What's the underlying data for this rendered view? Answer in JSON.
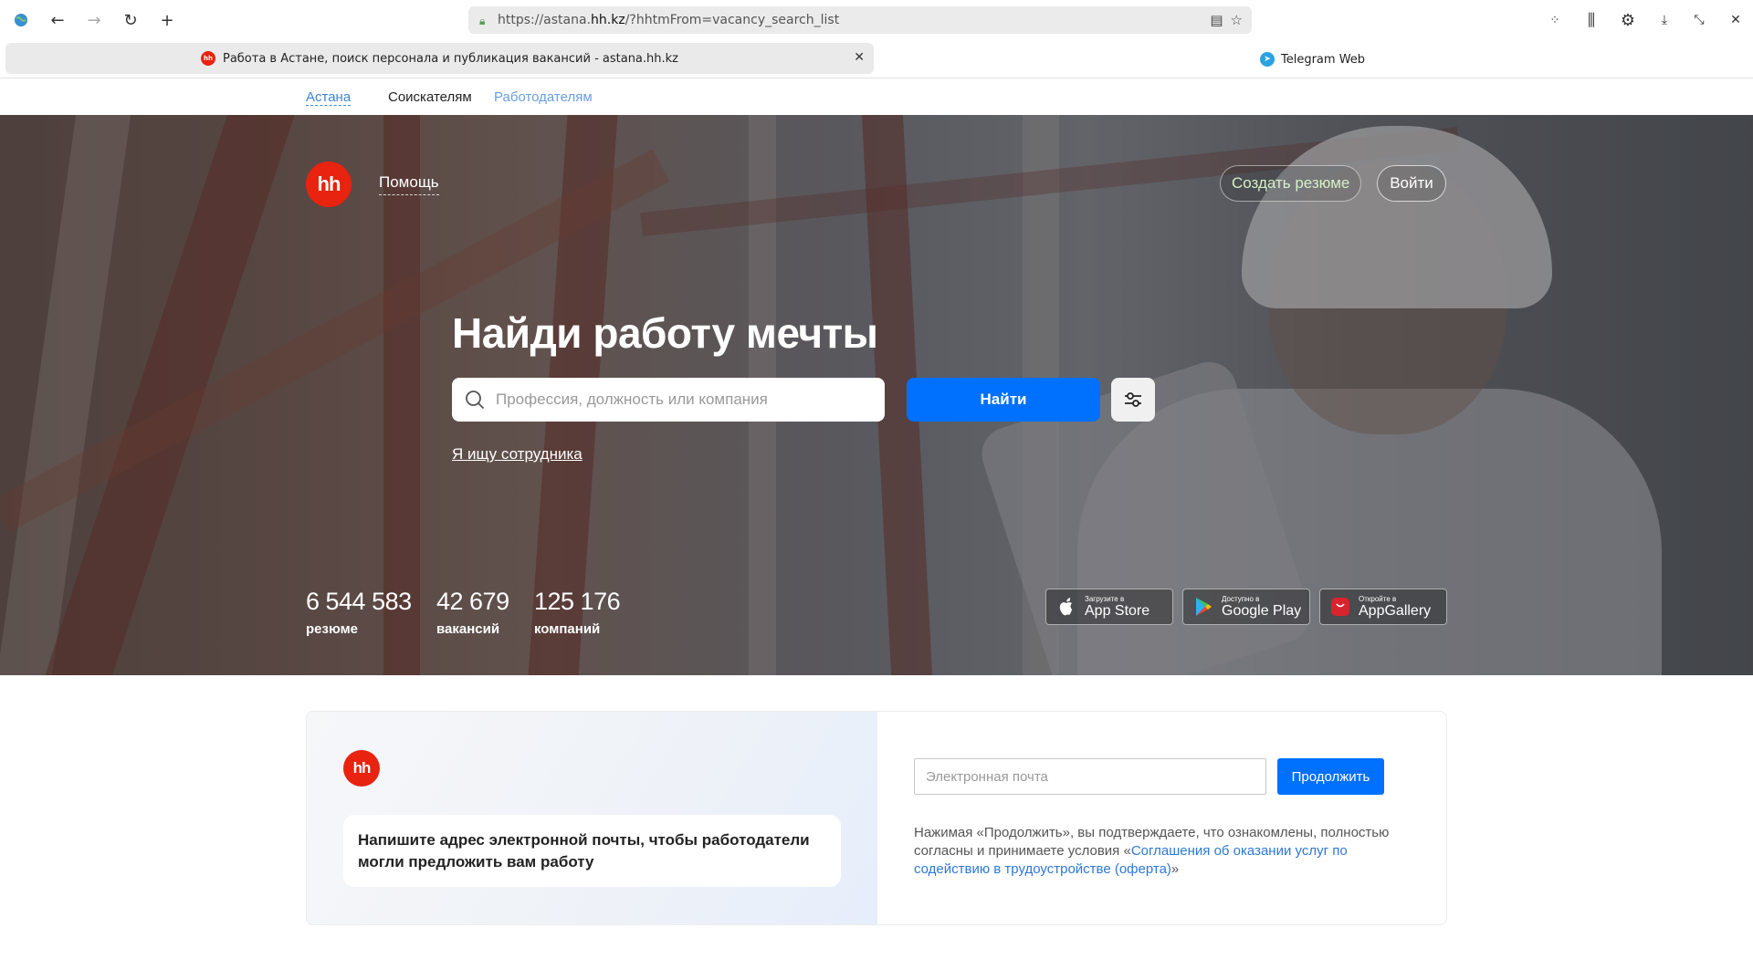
{
  "browser": {
    "url_prefix": "https://astana.",
    "url_host": "hh.kz",
    "url_rest": "/?hhtmFrom=vacancy_search_list",
    "active_tab_title": "Работа в Астане, поиск персонала и публикация вакансий - astana.hh.kz",
    "active_tab_favicon": "hh",
    "other_tab_title": "Telegram Web"
  },
  "topnav": {
    "city": "Астана",
    "seekers": "Соискателям",
    "employers": "Работодателям"
  },
  "header": {
    "logo": "hh",
    "help": "Помощь",
    "create_resume": "Создать резюме",
    "login": "Войти"
  },
  "hero": {
    "title": "Найди работу мечты",
    "search_placeholder": "Профессия, должность или компания",
    "find_button": "Найти",
    "employer_link": "Я ищу сотрудника"
  },
  "stats": [
    {
      "value": "6 544 583",
      "label": "резюме"
    },
    {
      "value": "42 679",
      "label": "вакансий"
    },
    {
      "value": "125 176",
      "label": "компаний"
    }
  ],
  "stores": [
    {
      "small": "Загрузите в",
      "big": "App Store",
      "icon": "apple-icon"
    },
    {
      "small": "Доступно в",
      "big": "Google Play",
      "icon": "google-play-icon"
    },
    {
      "small": "Откройте в",
      "big": "AppGallery",
      "icon": "huawei-appgallery-icon"
    }
  ],
  "subscribe": {
    "logo": "hh",
    "message": "Напишите адрес электронной почты, чтобы работодатели могли предложить вам работу",
    "email_placeholder": "Электронная почта",
    "continue_button": "Продолжить",
    "terms_before": "Нажимая «Продолжить», вы подтверждаете, что ознакомлены, полностью согласны и принимаете условия «",
    "terms_link": "Соглашения об оказании услуг по содействию в трудоустройстве (оферта)",
    "terms_after": "»"
  },
  "colors": {
    "brand_red": "#e8230f",
    "accent_blue": "#0070ff",
    "link_blue": "#2e78d6"
  }
}
